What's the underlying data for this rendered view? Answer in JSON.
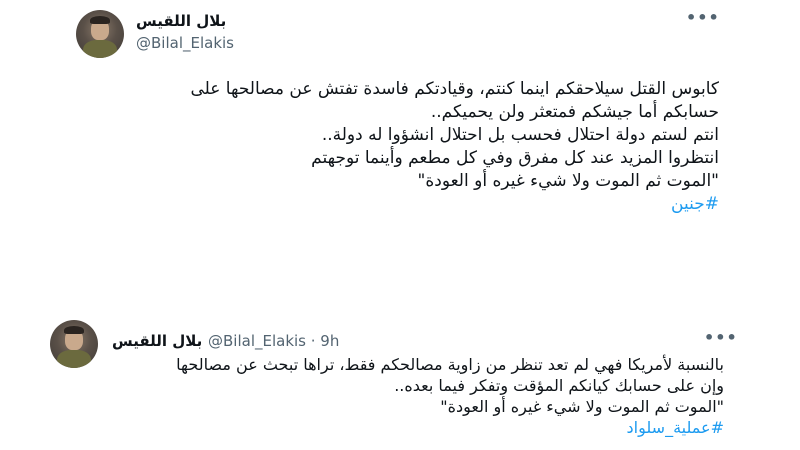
{
  "tweet1": {
    "display_name": "بلال اللقيس",
    "handle": "@Bilal_Elakis",
    "more_icon": "•••",
    "lines": [
      "كابوس القتل سيلاحقكم اينما كنتم، وقيادتكم فاسدة تفتش عن مصالحها على",
      "حسابكم أما جيشكم فمتعثر ولن يحميكم..",
      "انتم لستم دولة احتلال فحسب بل احتلال انشؤوا له دولة..",
      "انتظروا المزيد عند كل مفرق وفي كل مطعم وأينما توجهتم",
      "\"الموت ثم الموت ولا شيء غيره أو العودة\""
    ],
    "hashtag": "#جنين"
  },
  "tweet2": {
    "display_name": "بلال اللقيس",
    "handle_time": "@Bilal_Elakis · 9h",
    "more_icon": "•••",
    "lines": [
      "بالنسبة لأمريكا فهي لم تعد تنظر من زاوية مصالحكم فقط، تراها تبحث عن مصالحها",
      "وإن على حسابك كيانكم المؤقت وتفكر فيما بعده..",
      "\"الموت ثم الموت ولا شيء غيره أو العودة\""
    ],
    "hashtag": "#عملية_سلواد"
  },
  "colors": {
    "link": "#1d9bf0",
    "secondary": "#536471",
    "text": "#0f1419"
  }
}
